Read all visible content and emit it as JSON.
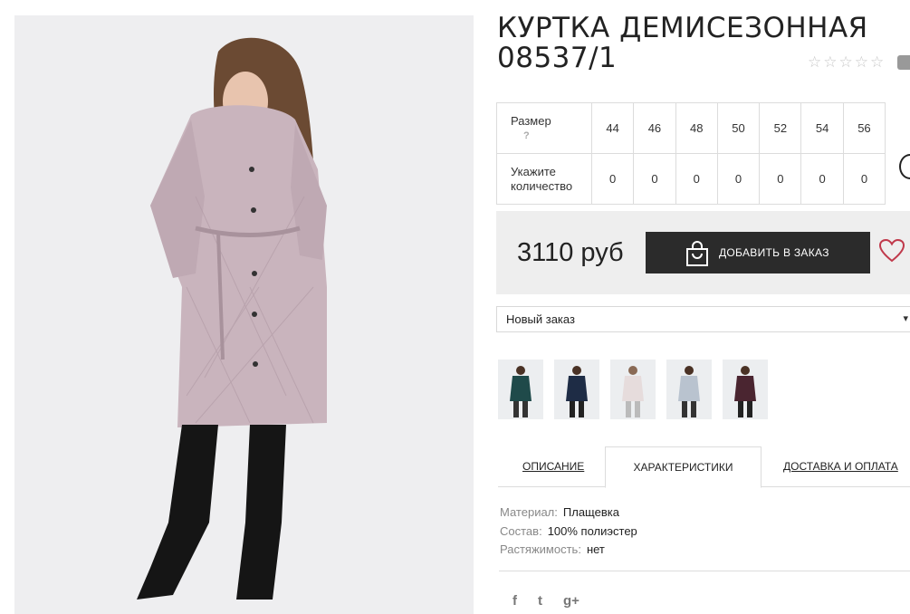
{
  "product": {
    "title_line1": "КУРТКА ДЕМИСЕЗОННАЯ",
    "title_line2": "08537/1",
    "rating_stars": 5,
    "rating_value": 0
  },
  "size_table": {
    "size_label": "Размер",
    "size_hint": "?",
    "qty_label_1": "Укажите",
    "qty_label_2": "количество",
    "sizes": [
      "44",
      "46",
      "48",
      "50",
      "52",
      "54",
      "56"
    ],
    "quantities": [
      "0",
      "0",
      "0",
      "0",
      "0",
      "0",
      "0"
    ]
  },
  "purchase": {
    "price": "3110 руб",
    "add_button_label": "ДОБАВИТЬ В ЗАКАЗ"
  },
  "order_select": {
    "selected": "Новый заказ"
  },
  "thumbnails": [
    {
      "color": "#1f4a4a"
    },
    {
      "color": "#1e2c45"
    },
    {
      "color": "#e6dcdc"
    },
    {
      "color": "#b9c3cf"
    },
    {
      "color": "#4a2530"
    }
  ],
  "tabs": {
    "description": "ОПИСАНИЕ",
    "characteristics": "ХАРАКТЕРИСТИКИ",
    "delivery": "ДОСТАВКА И ОПЛАТА"
  },
  "characteristics": [
    {
      "key": "Материал:",
      "value": "Плащевка"
    },
    {
      "key": "Состав:",
      "value": "100% полиэстер"
    },
    {
      "key": "Растяжимость:",
      "value": "нет"
    }
  ],
  "social": {
    "facebook": "f",
    "twitter": "t",
    "google": "g+"
  },
  "colors": {
    "button_bg": "#2b2b2b",
    "heart": "#c0394b",
    "panel_bg": "#eeeeee",
    "jacket": "#c9b4bd"
  }
}
